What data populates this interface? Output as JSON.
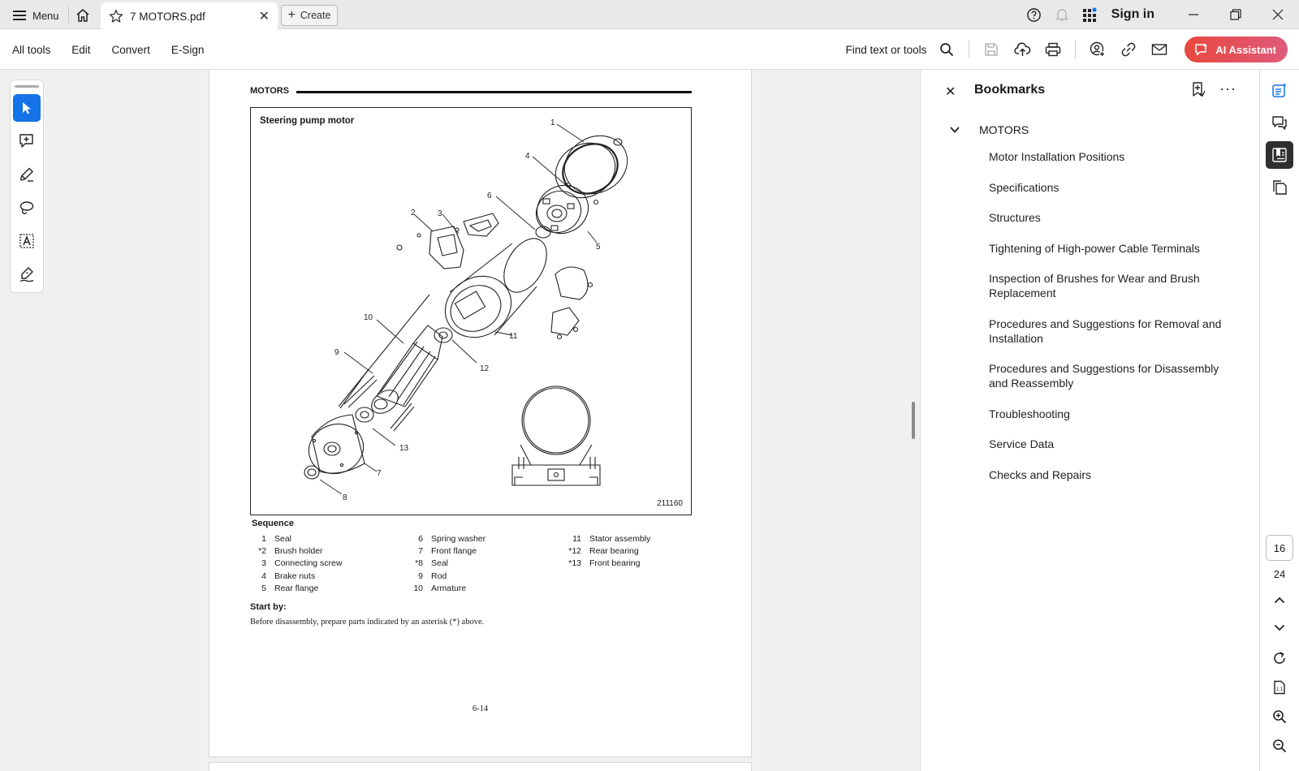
{
  "tabbar": {
    "menu_label": "Menu",
    "tab_title": "7 MOTORS.pdf",
    "create_label": "Create",
    "sign_in": "Sign in"
  },
  "toolbar": {
    "menu_items": [
      "All tools",
      "Edit",
      "Convert",
      "E-Sign"
    ],
    "find_label": "Find text or tools",
    "ai_label": "AI Assistant"
  },
  "page": {
    "header": "MOTORS",
    "figure_title": "Steering pump motor",
    "figure_id": "211160",
    "callouts": [
      "1",
      "2",
      "3",
      "4",
      "5",
      "6",
      "7",
      "8",
      "9",
      "10",
      "11",
      "12",
      "13"
    ],
    "sequence_title": "Sequence",
    "sequence_col1": [
      {
        "num": "1",
        "label": "Seal"
      },
      {
        "num": "*2",
        "label": "Brush holder"
      },
      {
        "num": "3",
        "label": "Connecting screw"
      },
      {
        "num": "4",
        "label": "Brake nuts"
      },
      {
        "num": "5",
        "label": "Rear flange"
      }
    ],
    "sequence_col2": [
      {
        "num": "6",
        "label": "Spring washer"
      },
      {
        "num": "7",
        "label": "Front flange"
      },
      {
        "num": "*8",
        "label": "Seal"
      },
      {
        "num": "9",
        "label": "Rod"
      },
      {
        "num": "10",
        "label": "Armature"
      }
    ],
    "sequence_col3": [
      {
        "num": "11",
        "label": "Stator assembly"
      },
      {
        "num": "*12",
        "label": "Rear bearing"
      },
      {
        "num": "*13",
        "label": "Front bearing"
      }
    ],
    "start_by": "Start by:",
    "note": "Before disassembly, prepare parts indicated by an asterisk (*) above.",
    "page_number": "6-14"
  },
  "bookmarks": {
    "title": "Bookmarks",
    "root": "MOTORS",
    "items": [
      "Motor Installation Positions",
      "Specifications",
      "Structures",
      "Tightening of High-power Cable Terminals",
      "Inspection of Brushes for Wear and Brush Replacement",
      "Procedures and Suggestions for Removal and Installation",
      "Procedures and Suggestions for Disassembly and Reassembly",
      "Troubleshooting",
      "Service Data",
      "Checks and Repairs"
    ]
  },
  "rail": {
    "current_page": "16",
    "total_pages": "24"
  },
  "colors": {
    "accent": "#1473e6",
    "ai_button": "#e8483f"
  }
}
